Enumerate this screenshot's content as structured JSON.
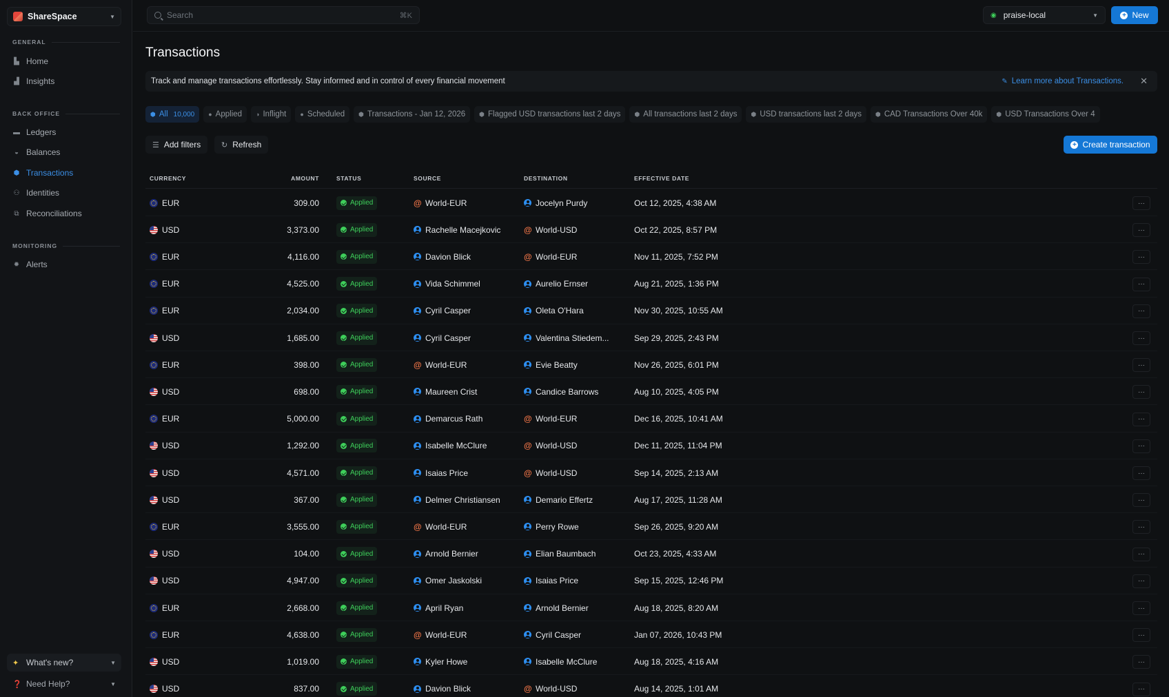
{
  "workspace": {
    "name": "ShareSpace"
  },
  "sidebar": {
    "sections": [
      {
        "title": "GENERAL",
        "items": [
          {
            "label": "Home",
            "icon": "home-icon"
          },
          {
            "label": "Insights",
            "icon": "chart-icon"
          }
        ]
      },
      {
        "title": "BACK OFFICE",
        "items": [
          {
            "label": "Ledgers",
            "icon": "folder-icon"
          },
          {
            "label": "Balances",
            "icon": "coins-icon"
          },
          {
            "label": "Transactions",
            "icon": "cube-icon",
            "active": true
          },
          {
            "label": "Identities",
            "icon": "users-icon"
          },
          {
            "label": "Reconciliations",
            "icon": "reconcile-icon"
          }
        ]
      },
      {
        "title": "MONITORING",
        "items": [
          {
            "label": "Alerts",
            "icon": "bug-icon"
          }
        ]
      }
    ],
    "whats_new": "What's new?",
    "need_help": "Need Help?"
  },
  "topbar": {
    "search_placeholder": "Search",
    "search_shortcut": "⌘K",
    "environment": "praise-local",
    "new_label": "New"
  },
  "page": {
    "title": "Transactions",
    "banner_text": "Track and manage transactions effortlessly. Stay informed and in control of every financial movement",
    "banner_link": "Learn more about Transactions."
  },
  "tabs": [
    {
      "label": "All",
      "count": "10,000",
      "active": true
    },
    {
      "label": "Applied"
    },
    {
      "label": "Inflight"
    },
    {
      "label": "Scheduled"
    },
    {
      "label": "Transactions - Jan 12, 2026"
    },
    {
      "label": "Flagged USD transactions last 2 days"
    },
    {
      "label": "All transactions last 2 days"
    },
    {
      "label": "USD transactions last 2 days"
    },
    {
      "label": "CAD Transactions Over 40k"
    },
    {
      "label": "USD Transactions Over 4"
    }
  ],
  "toolbar": {
    "add_filters": "Add filters",
    "refresh": "Refresh",
    "create": "Create transaction"
  },
  "table": {
    "columns": {
      "currency": "CURRENCY",
      "amount": "AMOUNT",
      "status": "STATUS",
      "source": "SOURCE",
      "destination": "DESTINATION",
      "effective_date": "EFFECTIVE DATE"
    },
    "rows": [
      {
        "currency": "EUR",
        "amount": "309.00",
        "status": "Applied",
        "source": "World-EUR",
        "source_type": "world",
        "destination": "Jocelyn Purdy",
        "destination_type": "person",
        "date": "Oct 12, 2025, 4:38 AM"
      },
      {
        "currency": "USD",
        "amount": "3,373.00",
        "status": "Applied",
        "source": "Rachelle Macejkovic",
        "source_type": "person",
        "destination": "World-USD",
        "destination_type": "world",
        "date": "Oct 22, 2025, 8:57 PM"
      },
      {
        "currency": "EUR",
        "amount": "4,116.00",
        "status": "Applied",
        "source": "Davion Blick",
        "source_type": "person",
        "destination": "World-EUR",
        "destination_type": "world",
        "date": "Nov 11, 2025, 7:52 PM"
      },
      {
        "currency": "EUR",
        "amount": "4,525.00",
        "status": "Applied",
        "source": "Vida Schimmel",
        "source_type": "person",
        "destination": "Aurelio Ernser",
        "destination_type": "person",
        "date": "Aug 21, 2025, 1:36 PM"
      },
      {
        "currency": "EUR",
        "amount": "2,034.00",
        "status": "Applied",
        "source": "Cyril Casper",
        "source_type": "person",
        "destination": "Oleta O'Hara",
        "destination_type": "person",
        "date": "Nov 30, 2025, 10:55 AM"
      },
      {
        "currency": "USD",
        "amount": "1,685.00",
        "status": "Applied",
        "source": "Cyril Casper",
        "source_type": "person",
        "destination": "Valentina Stiedem...",
        "destination_type": "person",
        "date": "Sep 29, 2025, 2:43 PM"
      },
      {
        "currency": "EUR",
        "amount": "398.00",
        "status": "Applied",
        "source": "World-EUR",
        "source_type": "world",
        "destination": "Evie Beatty",
        "destination_type": "person",
        "date": "Nov 26, 2025, 6:01 PM"
      },
      {
        "currency": "USD",
        "amount": "698.00",
        "status": "Applied",
        "source": "Maureen Crist",
        "source_type": "person",
        "destination": "Candice Barrows",
        "destination_type": "person",
        "date": "Aug 10, 2025, 4:05 PM"
      },
      {
        "currency": "EUR",
        "amount": "5,000.00",
        "status": "Applied",
        "source": "Demarcus Rath",
        "source_type": "person",
        "destination": "World-EUR",
        "destination_type": "world",
        "date": "Dec 16, 2025, 10:41 AM"
      },
      {
        "currency": "USD",
        "amount": "1,292.00",
        "status": "Applied",
        "source": "Isabelle McClure",
        "source_type": "person",
        "destination": "World-USD",
        "destination_type": "world",
        "date": "Dec 11, 2025, 11:04 PM"
      },
      {
        "currency": "USD",
        "amount": "4,571.00",
        "status": "Applied",
        "source": "Isaias Price",
        "source_type": "person",
        "destination": "World-USD",
        "destination_type": "world",
        "date": "Sep 14, 2025, 2:13 AM"
      },
      {
        "currency": "USD",
        "amount": "367.00",
        "status": "Applied",
        "source": "Delmer Christiansen",
        "source_type": "person",
        "destination": "Demario Effertz",
        "destination_type": "person",
        "date": "Aug 17, 2025, 11:28 AM"
      },
      {
        "currency": "EUR",
        "amount": "3,555.00",
        "status": "Applied",
        "source": "World-EUR",
        "source_type": "world",
        "destination": "Perry Rowe",
        "destination_type": "person",
        "date": "Sep 26, 2025, 9:20 AM"
      },
      {
        "currency": "USD",
        "amount": "104.00",
        "status": "Applied",
        "source": "Arnold Bernier",
        "source_type": "person",
        "destination": "Elian Baumbach",
        "destination_type": "person",
        "date": "Oct 23, 2025, 4:33 AM"
      },
      {
        "currency": "USD",
        "amount": "4,947.00",
        "status": "Applied",
        "source": "Omer Jaskolski",
        "source_type": "person",
        "destination": "Isaias Price",
        "destination_type": "person",
        "date": "Sep 15, 2025, 12:46 PM"
      },
      {
        "currency": "EUR",
        "amount": "2,668.00",
        "status": "Applied",
        "source": "April Ryan",
        "source_type": "person",
        "destination": "Arnold Bernier",
        "destination_type": "person",
        "date": "Aug 18, 2025, 8:20 AM"
      },
      {
        "currency": "EUR",
        "amount": "4,638.00",
        "status": "Applied",
        "source": "World-EUR",
        "source_type": "world",
        "destination": "Cyril Casper",
        "destination_type": "person",
        "date": "Jan 07, 2026, 10:43 PM"
      },
      {
        "currency": "USD",
        "amount": "1,019.00",
        "status": "Applied",
        "source": "Kyler Howe",
        "source_type": "person",
        "destination": "Isabelle McClure",
        "destination_type": "person",
        "date": "Aug 18, 2025, 4:16 AM"
      },
      {
        "currency": "USD",
        "amount": "837.00",
        "status": "Applied",
        "source": "Davion Blick",
        "source_type": "person",
        "destination": "World-USD",
        "destination_type": "world",
        "date": "Aug 14, 2025, 1:01 AM"
      }
    ]
  },
  "colors": {
    "accent": "#1578d6",
    "link": "#3b8fe6",
    "success": "#3ecf5a",
    "world": "#ee7447",
    "background": "#0f1113"
  }
}
